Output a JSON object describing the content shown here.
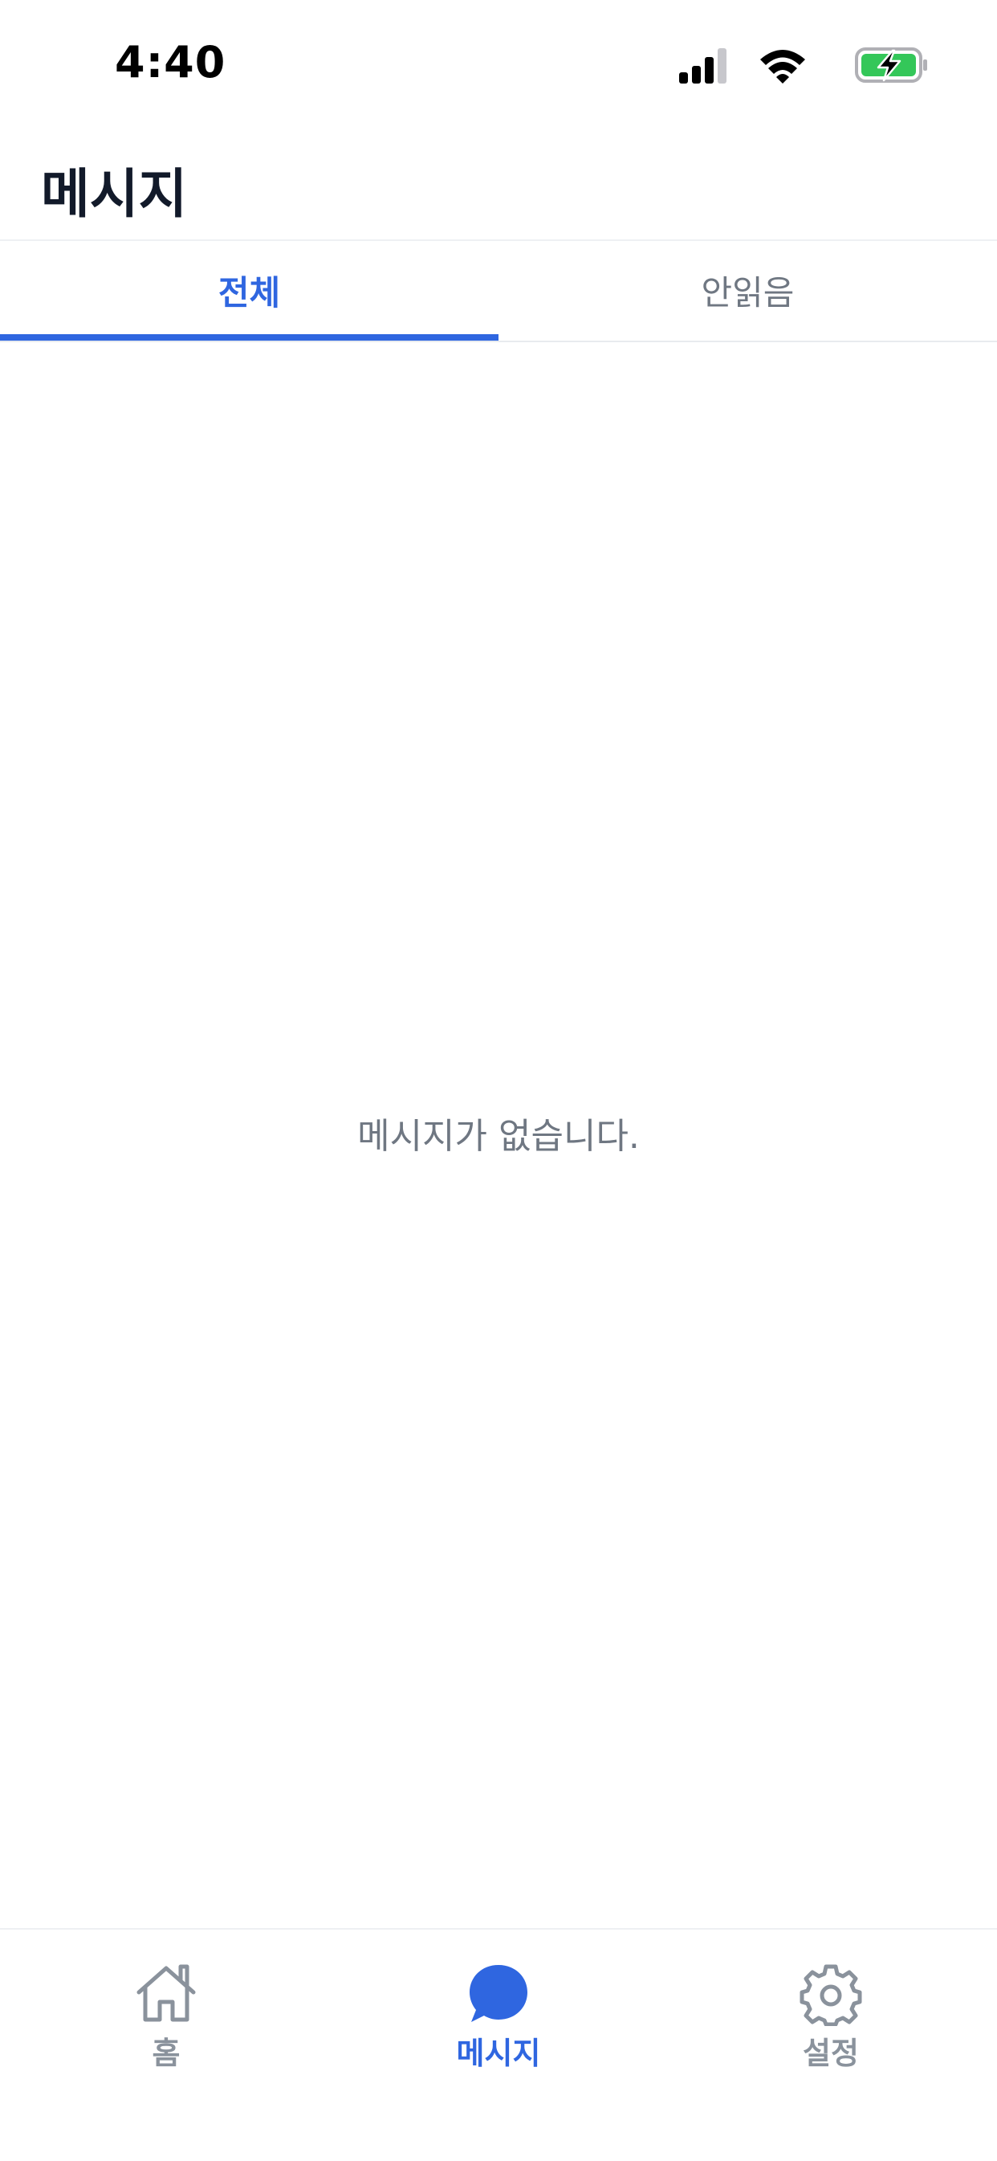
{
  "status_bar": {
    "time": "4:40",
    "icons": [
      "signal-icon",
      "wifi-icon",
      "battery-charging-icon"
    ],
    "battery_color": "#34c759"
  },
  "header": {
    "title": "메시지"
  },
  "tabs": [
    {
      "label": "전체",
      "active": true
    },
    {
      "label": "안읽음",
      "active": false
    }
  ],
  "empty_state": {
    "text": "메시지가 없습니다."
  },
  "bottom_nav": [
    {
      "label": "홈",
      "icon": "home-icon",
      "active": false
    },
    {
      "label": "메시지",
      "icon": "chat-bubble-icon",
      "active": true
    },
    {
      "label": "설정",
      "icon": "gear-icon",
      "active": false
    }
  ],
  "colors": {
    "accent": "#2f66e0",
    "title_text": "#121a2a",
    "muted_text": "#6f7782",
    "inactive_icon": "#8a929c"
  }
}
